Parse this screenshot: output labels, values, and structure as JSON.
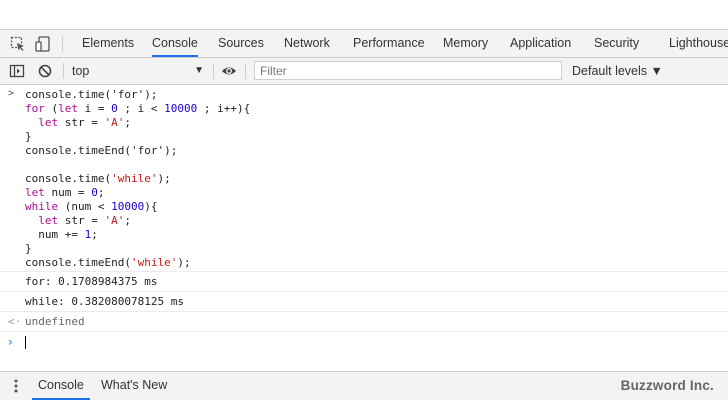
{
  "tabs": [
    {
      "label": "Elements",
      "active": false
    },
    {
      "label": "Console",
      "active": true
    },
    {
      "label": "Sources",
      "active": false
    },
    {
      "label": "Network",
      "active": false
    },
    {
      "label": "Performance",
      "active": false
    },
    {
      "label": "Memory",
      "active": false
    },
    {
      "label": "Application",
      "active": false
    },
    {
      "label": "Security",
      "active": false
    },
    {
      "label": "Lighthouse",
      "active": false
    }
  ],
  "toolbar": {
    "context": "top",
    "filter_placeholder": "Filter",
    "filter_value": "",
    "levels_label": "Default levels ▼"
  },
  "console": {
    "code": [
      "console.time('for');",
      "for (let i = 0 ; i < 10000 ; i++){",
      "  let str = 'A';",
      "}",
      "console.timeEnd('for');",
      "",
      "console.time('while');",
      "let num = 0;",
      "while (num < 10000){",
      "  let str = 'A';",
      "  num += 1;",
      "}",
      "console.timeEnd('while');"
    ],
    "outputs": [
      "for: 0.1708984375 ms",
      "while: 0.382080078125 ms"
    ],
    "result": "undefined"
  },
  "drawer": {
    "tabs": [
      {
        "label": "Console",
        "active": true
      },
      {
        "label": "What's New",
        "active": false
      }
    ]
  },
  "brand": "Buzzword Inc.",
  "icons": {
    "inspect": "inspect-element-icon",
    "device": "device-toolbar-icon",
    "sidebar": "console-sidebar-icon",
    "clear": "clear-console-icon",
    "eye": "live-expression-eye-icon",
    "kebab": "more-options-icon"
  },
  "colors": {
    "accent": "#1a73e8",
    "keyword": "#aa0d91",
    "number": "#1c00cf",
    "string": "#c41a16"
  }
}
